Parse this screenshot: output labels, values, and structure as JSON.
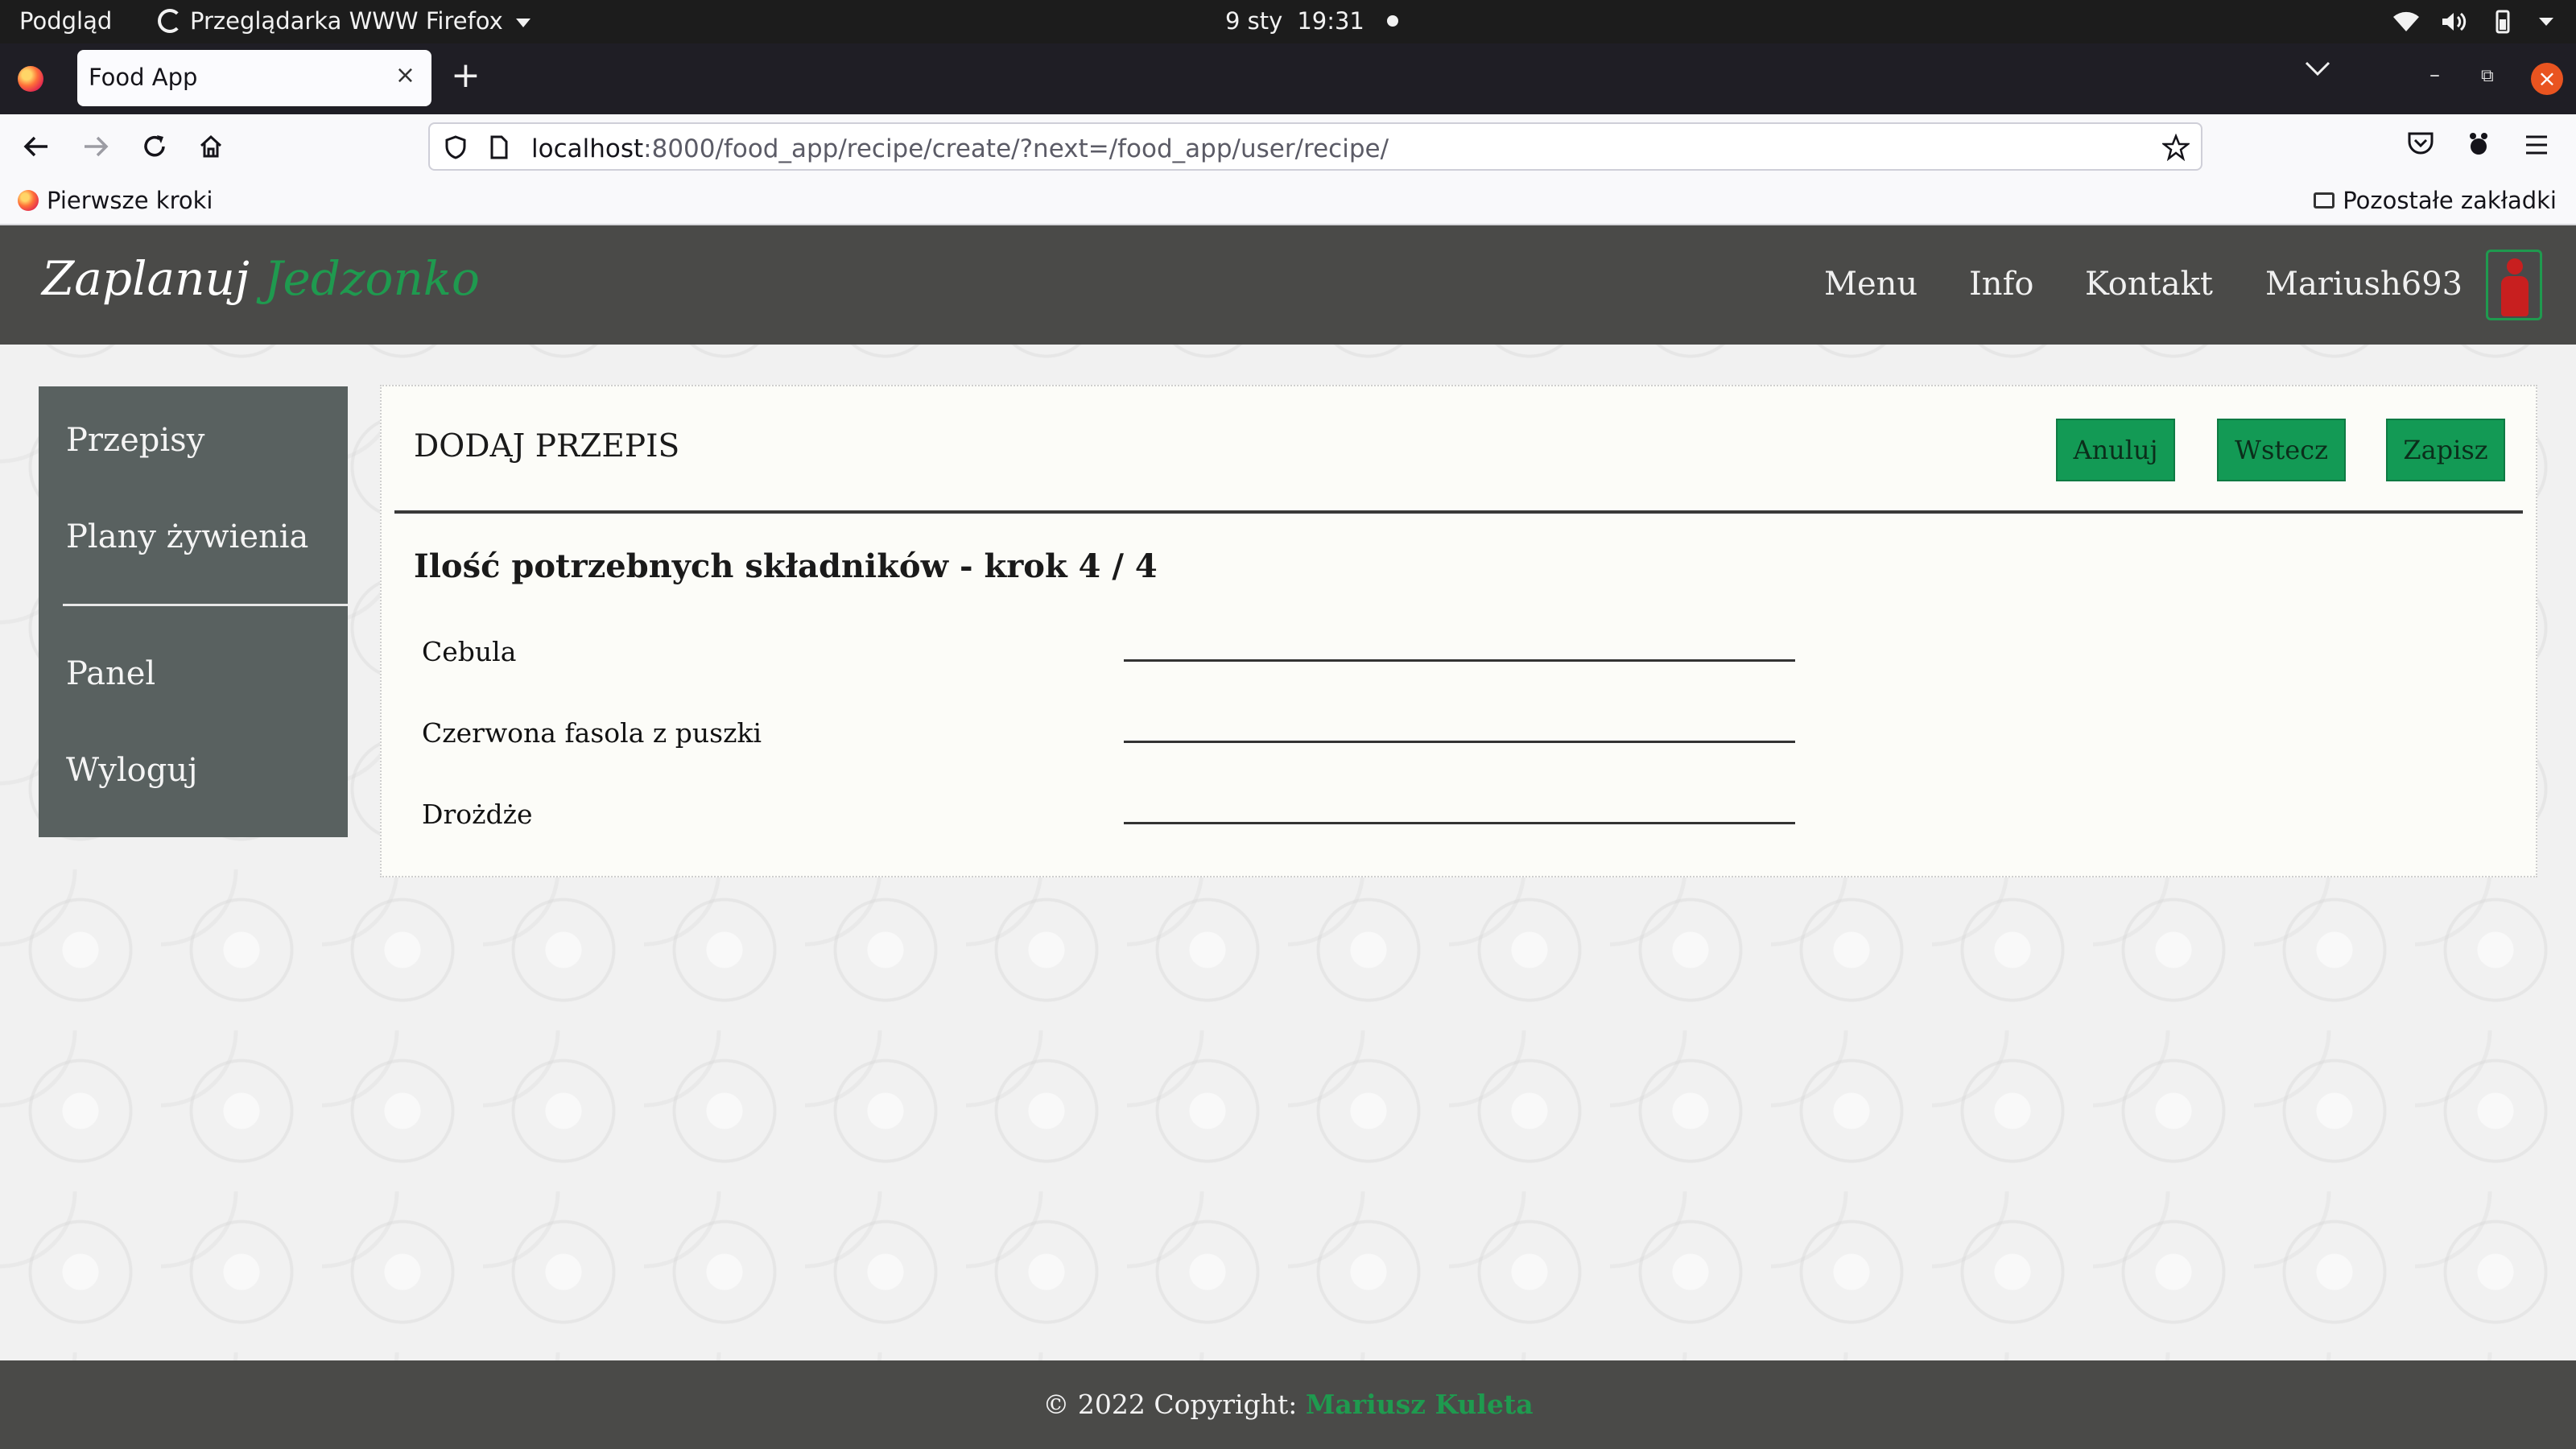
{
  "os_bar": {
    "activities": "Podgląd",
    "app_name": "Przeglądarka WWW Firefox",
    "date": "9 sty",
    "time": "19:31"
  },
  "browser": {
    "tab_title": "Food App",
    "tab_close": "×",
    "new_tab": "+",
    "url_host": "localhost",
    "url_rest": ":8000/food_app/recipe/create/?next=/food_app/user/recipe/",
    "bookmark_first": "Pierwsze kroki",
    "bookmark_other": "Pozostałe zakładki"
  },
  "site": {
    "brand_part1": "Zaplanuj",
    "brand_part2": "Jedzonko",
    "brand_color": "#1f9a4f",
    "nav": [
      "Menu",
      "Info",
      "Kontakt",
      "Mariush693"
    ]
  },
  "sidebar": {
    "items": [
      "Przepisy",
      "Plany żywienia",
      "Panel",
      "Wyloguj"
    ]
  },
  "form": {
    "title": "DODAJ PRZEPIS",
    "buttons": {
      "cancel": "Anuluj",
      "back": "Wstecz",
      "save": "Zapisz"
    },
    "button_color": "#139a55",
    "step_title": "Ilość potrzebnych składników - krok 4 / 4",
    "ingredients": [
      {
        "label": "Cebula",
        "value": ""
      },
      {
        "label": "Czerwona fasola z puszki",
        "value": ""
      },
      {
        "label": "Drożdże",
        "value": ""
      }
    ]
  },
  "footer": {
    "copyright": "© 2022 Copyright:",
    "author": "Mariusz Kuleta"
  }
}
